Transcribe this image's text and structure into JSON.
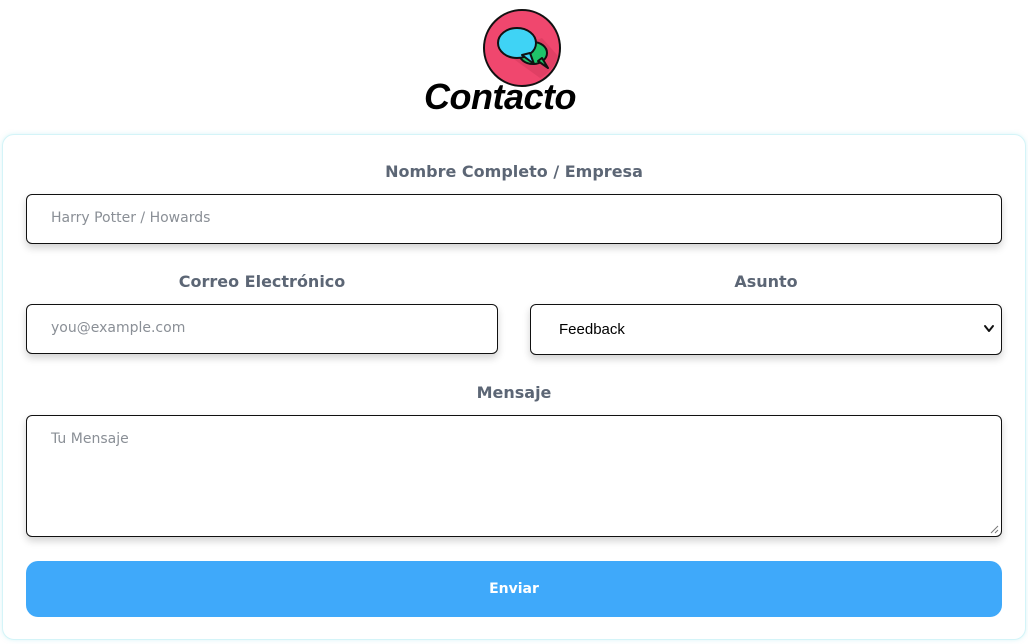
{
  "header": {
    "title": "Contacto",
    "logo_icon": "chat-bubbles-icon"
  },
  "form": {
    "name": {
      "label": "Nombre Completo / Empresa",
      "placeholder": "Harry Potter / Howards"
    },
    "email": {
      "label": "Correo Electrónico",
      "placeholder": "you@example.com"
    },
    "subject": {
      "label": "Asunto",
      "value": "Feedback"
    },
    "message": {
      "label": "Mensaje",
      "placeholder": "Tu Mensaje"
    },
    "submit_label": "Enviar"
  },
  "colors": {
    "button": "#3fa9fa",
    "label": "#5c6675",
    "logo_circle": "#f0476e",
    "bubble_blue": "#3fd3f5",
    "bubble_green": "#1fc46a"
  }
}
